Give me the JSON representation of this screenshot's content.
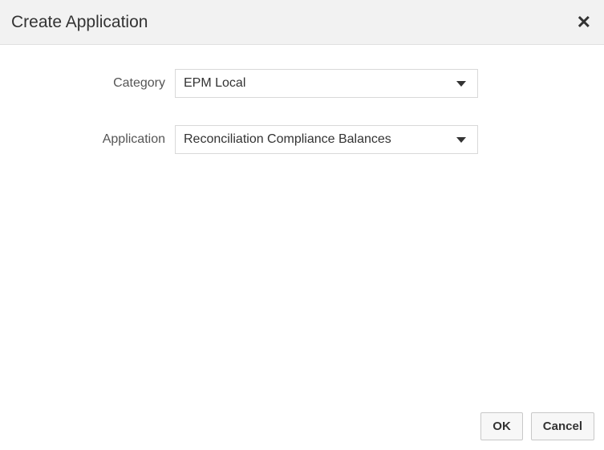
{
  "dialog": {
    "title": "Create Application"
  },
  "form": {
    "category": {
      "label": "Category",
      "value": "EPM Local"
    },
    "application": {
      "label": "Application",
      "value": "Reconciliation Compliance Balances"
    }
  },
  "footer": {
    "ok": "OK",
    "cancel": "Cancel"
  }
}
